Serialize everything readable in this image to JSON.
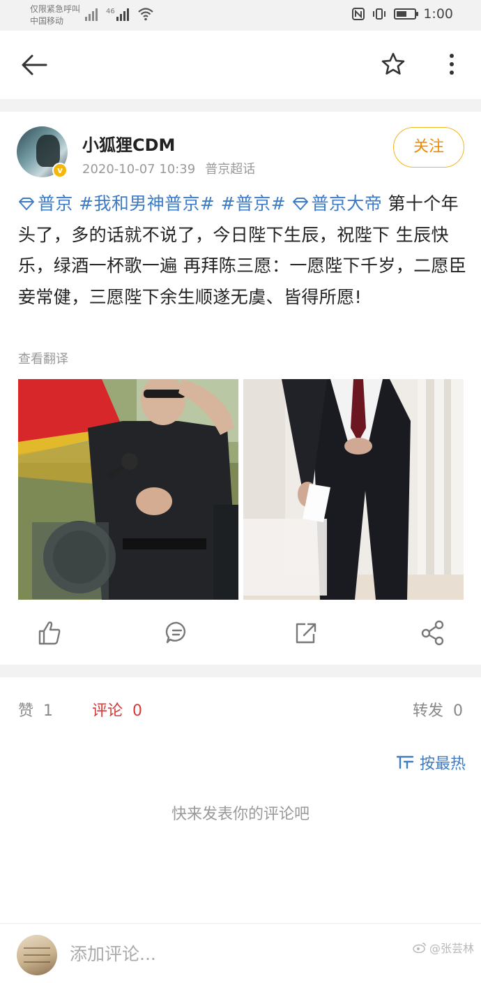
{
  "status_bar": {
    "line1": "仅限紧急呼叫",
    "line2": "中国移动",
    "network": "46",
    "time": "1:00",
    "battery_percent": 60
  },
  "header": {
    "back_icon": "back-arrow-icon",
    "star_icon": "star-outline-icon",
    "more_icon": "more-vertical-icon"
  },
  "post": {
    "username": "小狐狸CDM",
    "timestamp": "2020-10-07 10:39",
    "source": "普京超话",
    "follow_label": "关注",
    "verified_badge": "v",
    "topics": {
      "t1": "普京",
      "t2": "#我和男神普京#",
      "t3": "#普京#",
      "t4": "普京大帝"
    },
    "text": "第十个年头了，多的话就不说了，今日陛下生辰，祝陛下 生辰快乐，绿酒一杯歌一遍 再拜陈三愿：一愿陛下千岁，二愿臣妾常健，三愿陛下余生顺遂无虞、皆得所愿!",
    "translate_label": "查看翻译",
    "topic_color": "#3d7bc6"
  },
  "stats": {
    "likes_label": "赞",
    "likes_count": "1",
    "comments_label": "评论",
    "comments_count": "0",
    "reposts_label": "转发",
    "reposts_count": "0"
  },
  "comments": {
    "sort_label": "按最热",
    "empty_text": "快来发表你的评论吧"
  },
  "bottom": {
    "placeholder": "添加评论...",
    "watermark": "@张芸林"
  }
}
